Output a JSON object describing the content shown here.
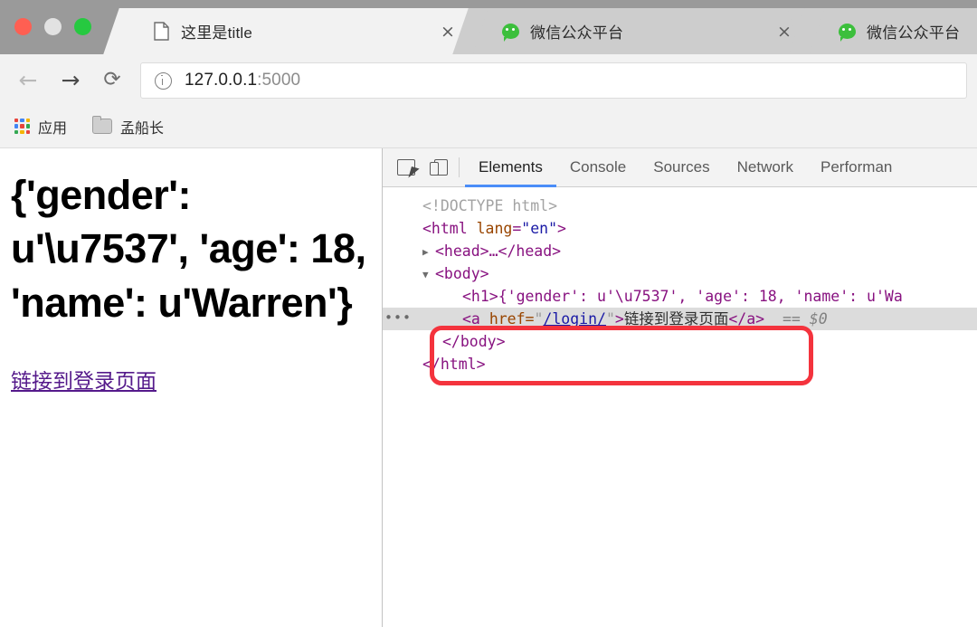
{
  "window": {
    "traffic_lights": [
      "close",
      "minimize",
      "zoom"
    ]
  },
  "browser": {
    "tabs": [
      {
        "title": "这里是title",
        "favicon": "page-icon",
        "active": true,
        "close_label": "×"
      },
      {
        "title": "微信公众平台",
        "favicon": "wechat-icon",
        "active": false,
        "close_label": "×"
      },
      {
        "title": "微信公众平台",
        "favicon": "wechat-icon",
        "active": false,
        "close_label": ""
      }
    ],
    "toolbar": {
      "back": "←",
      "forward": "→",
      "reload": "⟳",
      "url_host": "127.0.0.1",
      "url_port": ":5000",
      "security_icon": "info-icon"
    },
    "bookmarks": [
      {
        "label": "应用",
        "icon": "apps-grid-icon"
      },
      {
        "label": "孟船长",
        "icon": "folder-icon"
      }
    ]
  },
  "page": {
    "heading": "{'gender': u'\\u7537', 'age': 18, 'name': u'Warren'}",
    "link_text": "链接到登录页面",
    "link_color": "#551a8b"
  },
  "devtools": {
    "toolbar_icons": [
      "inspect-element-icon",
      "device-toolbar-icon"
    ],
    "tabs": [
      {
        "label": "Elements",
        "selected": true
      },
      {
        "label": "Console",
        "selected": false
      },
      {
        "label": "Sources",
        "selected": false
      },
      {
        "label": "Network",
        "selected": false
      },
      {
        "label": "Performan",
        "selected": false
      }
    ],
    "accent_color": "#4a8df8",
    "annotation_color": "#f4333d",
    "dom": {
      "doctype": "<!DOCTYPE html>",
      "html_open_tag": "<html",
      "html_attr_name": "lang",
      "html_attr_eq": "=",
      "html_attr_value": "\"en\"",
      "html_open_close": ">",
      "head_collapsed": "<head>…</head>",
      "body_open": "<body>",
      "h1_line": "<h1>{'gender': u'\\u7537', 'age': 18, 'name': u'Wa",
      "a_open_1": "<a ",
      "a_attr": "href=",
      "a_quote_open": "\"",
      "a_href": "/login/",
      "a_quote_close": "\"",
      "a_gt": ">",
      "a_text": "链接到登录页面",
      "a_close": "</a>",
      "selected_marker": "== $0",
      "ellipsis": "•••",
      "body_close": "</body>",
      "html_close": "</html>",
      "arrow_collapsed": "▶",
      "arrow_expanded": "▼"
    }
  }
}
